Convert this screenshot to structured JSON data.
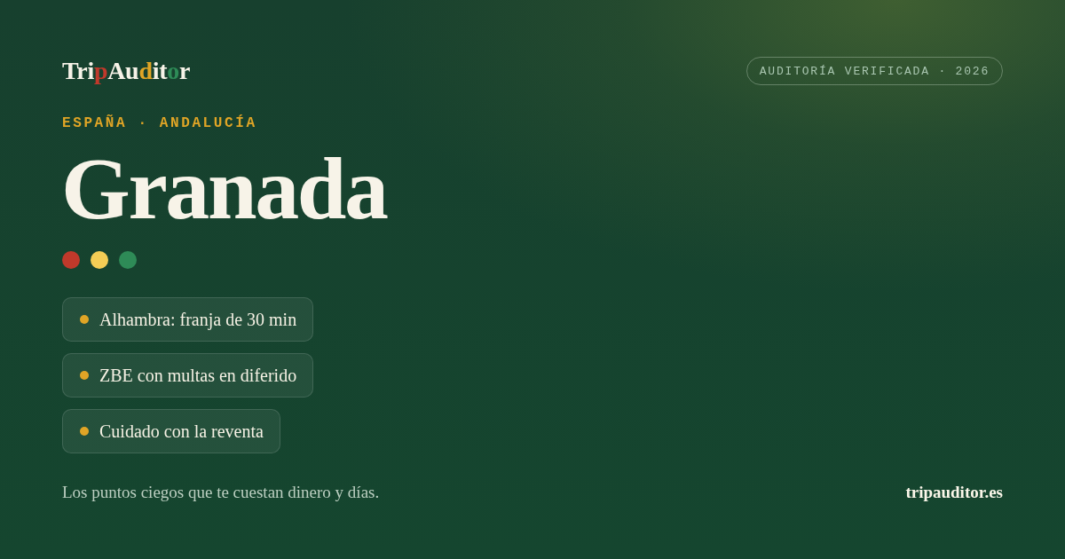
{
  "brand": {
    "logo": [
      {
        "text": "Tri",
        "color": "#f7f3e8"
      },
      {
        "text": "p",
        "color": "#c0392b"
      },
      {
        "text": "Au",
        "color": "#f7f3e8"
      },
      {
        "text": "d",
        "color": "#e0a526"
      },
      {
        "text": "it",
        "color": "#f7f3e8"
      },
      {
        "text": "o",
        "color": "#2e8b57"
      },
      {
        "text": "r",
        "color": "#f7f3e8"
      }
    ]
  },
  "badge": "AUDITORÍA VERIFICADA · 2026",
  "eyebrow": "ESPAÑA · ANDALUCÍA",
  "title": "Granada",
  "dots": [
    {
      "color": "#c0392b"
    },
    {
      "color": "#f4cd55"
    },
    {
      "color": "#2e8b57"
    }
  ],
  "facts": [
    "Alhambra: franja de 30 min",
    "ZBE con multas en diferido",
    "Cuidado con la reventa"
  ],
  "footer": {
    "tagline": "Los puntos ciegos que te cuestan dinero y días.",
    "domain": "tripauditor.es"
  }
}
